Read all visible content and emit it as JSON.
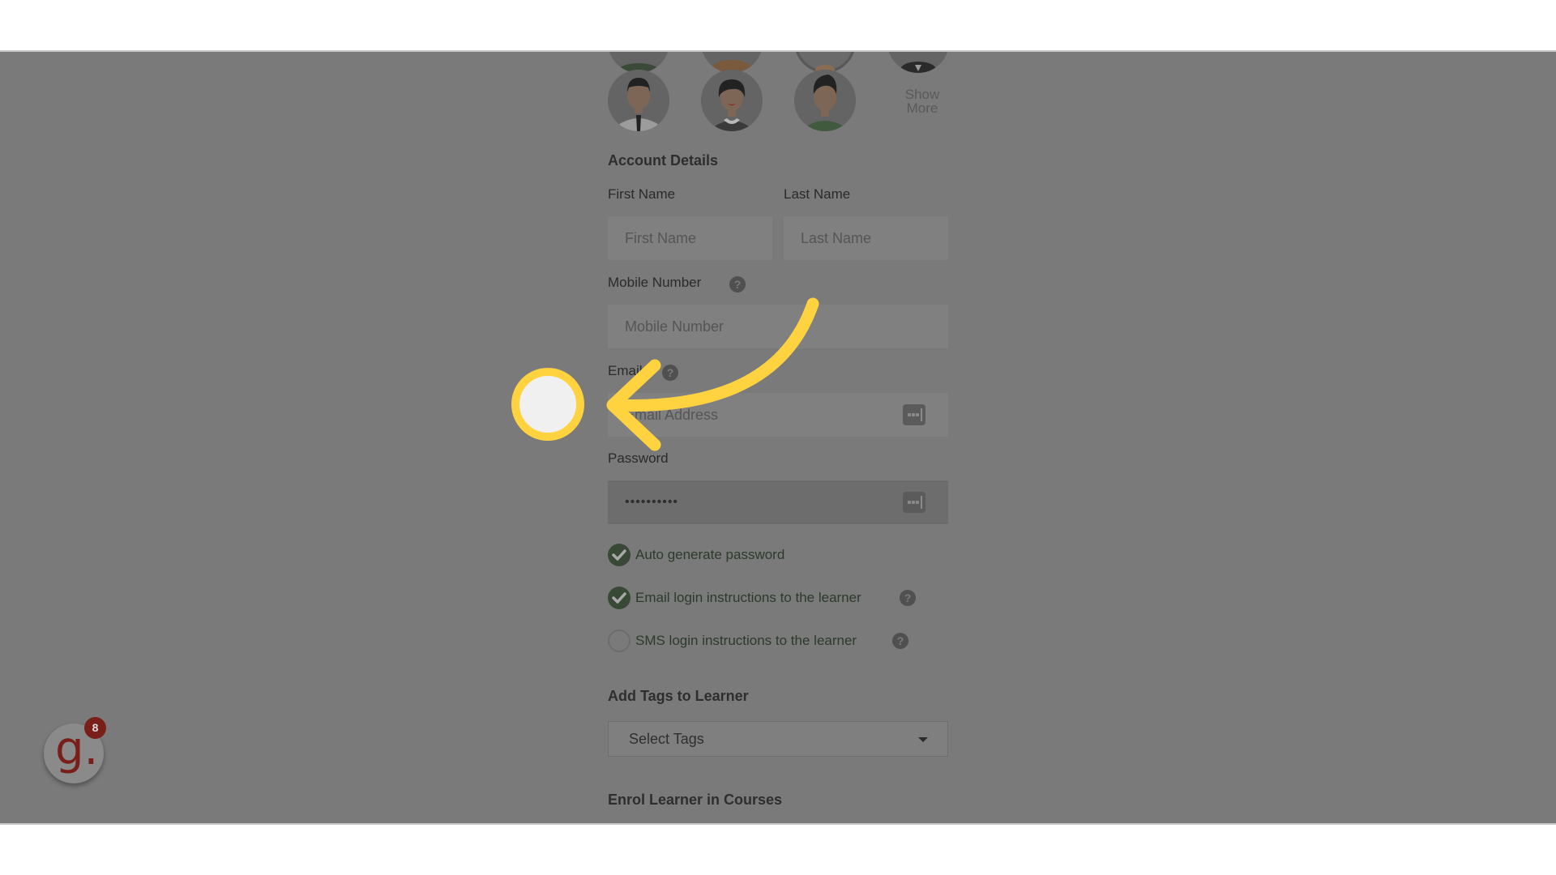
{
  "avatars": {
    "items": [
      {
        "name": "male-tie",
        "shirt": "#9a9a9a",
        "hair": "#222222"
      },
      {
        "name": "female-collar",
        "shirt": "#3a3a3a",
        "hair": "#222222"
      },
      {
        "name": "male-green",
        "shirt": "#3f5a3c",
        "hair": "#222222"
      }
    ],
    "show_more_label_line1": "Show",
    "show_more_label_line2": "More"
  },
  "account": {
    "section_title": "Account Details",
    "first_name": {
      "label": "First Name",
      "placeholder": "First Name",
      "value": ""
    },
    "last_name": {
      "label": "Last Name",
      "placeholder": "Last Name",
      "value": ""
    },
    "mobile": {
      "label": "Mobile Number",
      "placeholder": "Mobile Number",
      "value": "",
      "help_icon": "question-circle-icon"
    },
    "email": {
      "label": "Email",
      "placeholder": "Email Address",
      "value": "",
      "help_icon": "question-circle-icon",
      "trailing_icon": "password-manager-icon"
    },
    "password": {
      "label": "Password",
      "value": "••••••••••",
      "trailing_icon": "password-manager-icon"
    }
  },
  "options": [
    {
      "label": "Auto generate password",
      "checked": true,
      "help": false
    },
    {
      "label": "Email login instructions to the learner",
      "checked": true,
      "help": true
    },
    {
      "label": "SMS login instructions to the learner",
      "checked": false,
      "help": true
    }
  ],
  "tags": {
    "section_title": "Add Tags to Learner",
    "select_placeholder": "Select Tags"
  },
  "courses": {
    "section_title": "Enrol Learner in Courses"
  },
  "help_glyph": "?",
  "fab": {
    "logo_text": "g.",
    "badge_count": "8"
  },
  "annotation": {
    "color": "#FFD23F",
    "marker_fill": "#F0F0F0"
  },
  "colors": {
    "overlay_bg": "#7a7a7a",
    "check_on": "#384a36",
    "brand_red": "#7a1e1a"
  }
}
